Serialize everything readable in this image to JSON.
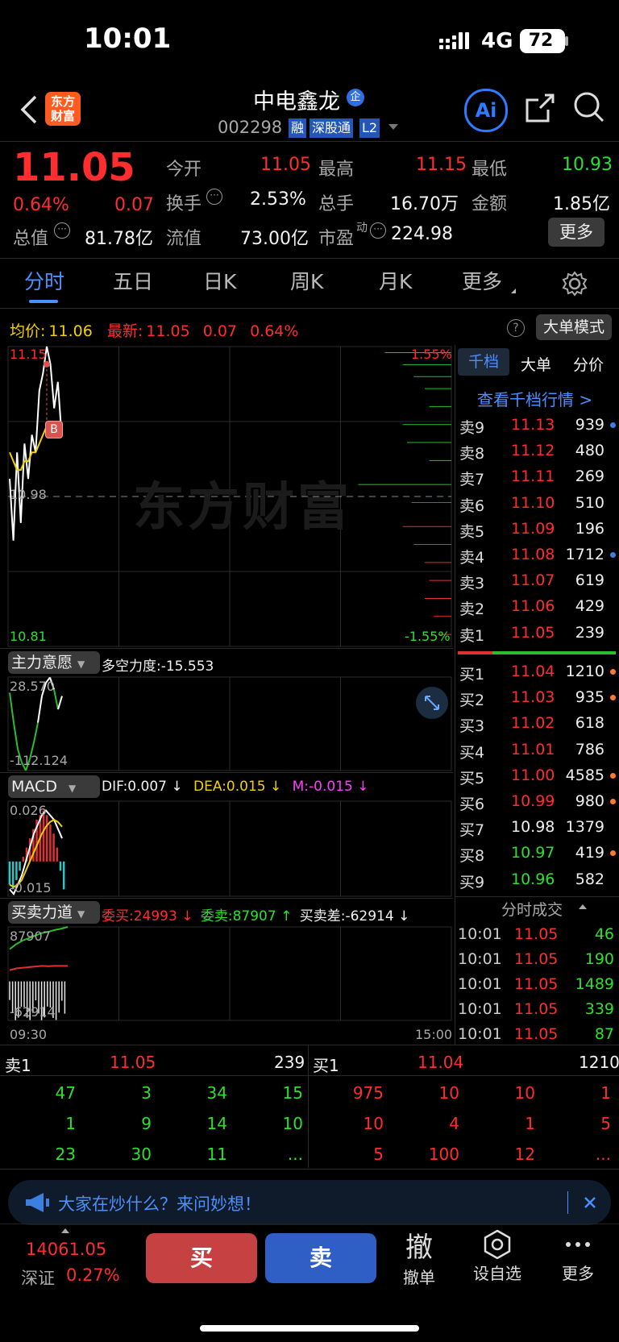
{
  "status_bar": {
    "time": "10:01",
    "network": "4G",
    "battery": "72"
  },
  "header": {
    "logo_line1": "东方",
    "logo_line2": "财富",
    "stock_name": "中电鑫龙",
    "enterprise_badge": "企",
    "stock_code": "002298",
    "tags": [
      "融",
      "深股通",
      "L2"
    ]
  },
  "quote": {
    "price": "11.05",
    "change_pct": "0.64%",
    "change": "0.07",
    "open_label": "今开",
    "open": "11.05",
    "high_label": "最高",
    "high": "11.15",
    "low_label": "最低",
    "low": "10.93",
    "turnover_label": "换手",
    "turnover": "2.53%",
    "volume_label": "总手",
    "volume": "16.70万",
    "amount_label": "金额",
    "amount": "1.85亿",
    "mktcap_label": "总值",
    "mktcap": "81.78亿",
    "float_label": "流值",
    "float": "73.00亿",
    "pe_label": "市盈",
    "pe_sup": "动",
    "pe": "224.98",
    "more_label": "更多"
  },
  "tabs": [
    "分时",
    "五日",
    "日K",
    "周K",
    "月K",
    "更多"
  ],
  "chart_header": {
    "avg_label": "均价:",
    "avg": "11.06",
    "latest_label": "最新:",
    "latest": "11.05",
    "chg": "0.07",
    "pct": "0.64%",
    "mode_label": "大单模式"
  },
  "chart_data": [
    {
      "type": "line",
      "title": "分时",
      "y_top_label": "11.15",
      "y_mid_label": "10.98",
      "y_bottom_label": "10.81",
      "right_top_label": "1.55%",
      "right_bottom_label": "-1.55%",
      "ylim": [
        10.81,
        11.15
      ],
      "x_labels": [
        "09:30",
        "15:00"
      ],
      "marker": "B",
      "watermark": "东方财富",
      "series": [
        {
          "name": "最新",
          "values": [
            11.0,
            10.93,
            11.03,
            10.95,
            11.04,
            11.0,
            11.05,
            11.03,
            11.1,
            11.12,
            11.15,
            11.13,
            11.08,
            11.11,
            11.05
          ]
        },
        {
          "name": "均价",
          "values": [
            11.03,
            11.02,
            11.01,
            11.01,
            11.02,
            11.02,
            11.03,
            11.03,
            11.04,
            11.05,
            11.06,
            11.06,
            11.06,
            11.06,
            11.06
          ]
        }
      ]
    },
    {
      "type": "line",
      "title": "主力意愿",
      "indicator_label": "多空力度:-15.553",
      "y_top_label": "28.570",
      "y_bottom_label": "-112.124",
      "ylim": [
        -112.124,
        28.57
      ],
      "series": [
        {
          "name": "line",
          "values": [
            5,
            -40,
            -80,
            -100,
            -112,
            -95,
            -70,
            -40,
            0,
            20,
            28,
            10,
            -20,
            0
          ]
        }
      ]
    },
    {
      "type": "bar",
      "title": "MACD",
      "dif_label": "DIF:0.007 ↓",
      "dea_label": "DEA:0.015 ↓",
      "m_label": "M:-0.015 ↓",
      "y_top_label": "0.026",
      "y_bottom_label": "-0.015",
      "ylim": [
        -0.015,
        0.026
      ],
      "bars": [
        -0.01,
        -0.012,
        -0.008,
        -0.004,
        0.002,
        0.006,
        0.01,
        0.014,
        0.018,
        0.02,
        0.022,
        0.02,
        0.016,
        0.012,
        0.006,
        -0.004,
        -0.012
      ]
    },
    {
      "type": "area",
      "title": "买卖力道",
      "buy_label": "委买:24993 ↓",
      "sell_label": "委卖:87907 ↑",
      "diff_label": "买卖差:-62914 ↓",
      "y_top_label": "87907",
      "y_bottom_label": "-62914",
      "ylim": [
        -62914,
        87907
      ]
    }
  ],
  "orderbook": {
    "tabs": [
      "千档",
      "大单",
      "分价"
    ],
    "view_all": "查看千档行情 >",
    "asks": [
      {
        "label": "卖9",
        "price": "11.13",
        "vol": "939",
        "dot": "blue"
      },
      {
        "label": "卖8",
        "price": "11.12",
        "vol": "480",
        "dot": ""
      },
      {
        "label": "卖7",
        "price": "11.11",
        "vol": "269",
        "dot": ""
      },
      {
        "label": "卖6",
        "price": "11.10",
        "vol": "510",
        "dot": ""
      },
      {
        "label": "卖5",
        "price": "11.09",
        "vol": "196",
        "dot": ""
      },
      {
        "label": "卖4",
        "price": "11.08",
        "vol": "1712",
        "dot": "blue"
      },
      {
        "label": "卖3",
        "price": "11.07",
        "vol": "619",
        "dot": ""
      },
      {
        "label": "卖2",
        "price": "11.06",
        "vol": "429",
        "dot": ""
      },
      {
        "label": "卖1",
        "price": "11.05",
        "vol": "239",
        "dot": ""
      }
    ],
    "bids": [
      {
        "label": "买1",
        "price": "11.04",
        "vol": "1210",
        "dot": "orange",
        "color": "red"
      },
      {
        "label": "买2",
        "price": "11.03",
        "vol": "935",
        "dot": "orange",
        "color": "red"
      },
      {
        "label": "买3",
        "price": "11.02",
        "vol": "618",
        "dot": "",
        "color": "red"
      },
      {
        "label": "买4",
        "price": "11.01",
        "vol": "786",
        "dot": "",
        "color": "red"
      },
      {
        "label": "买5",
        "price": "11.00",
        "vol": "4585",
        "dot": "orange",
        "color": "red"
      },
      {
        "label": "买6",
        "price": "10.99",
        "vol": "980",
        "dot": "orange",
        "color": "red"
      },
      {
        "label": "买7",
        "price": "10.98",
        "vol": "1379",
        "dot": "",
        "color": "white"
      },
      {
        "label": "买8",
        "price": "10.97",
        "vol": "419",
        "dot": "orange",
        "color": "green"
      },
      {
        "label": "买9",
        "price": "10.96",
        "vol": "582",
        "dot": "",
        "color": "green"
      }
    ],
    "trades_title": "分时成交",
    "trades": [
      {
        "time": "10:01",
        "price": "11.05",
        "vol": "46"
      },
      {
        "time": "10:01",
        "price": "11.05",
        "vol": "190"
      },
      {
        "time": "10:01",
        "price": "11.05",
        "vol": "1489"
      },
      {
        "time": "10:01",
        "price": "11.05",
        "vol": "339"
      },
      {
        "time": "10:01",
        "price": "11.05",
        "vol": "87"
      }
    ]
  },
  "queue": {
    "sell_label": "卖1",
    "sell_price": "11.05",
    "sell_vol": "239",
    "buy_label": "买1",
    "buy_price": "11.04",
    "buy_vol": "1210",
    "sell_rows": [
      [
        "47",
        "3",
        "34",
        "15"
      ],
      [
        "1",
        "9",
        "14",
        "10"
      ],
      [
        "23",
        "30",
        "11",
        "..."
      ]
    ],
    "buy_rows": [
      [
        "975",
        "10",
        "10",
        "1"
      ],
      [
        "10",
        "4",
        "1",
        "5"
      ],
      [
        "5",
        "100",
        "12",
        "..."
      ]
    ]
  },
  "banner": {
    "text": "大家在炒什么？来问妙想！"
  },
  "bottom_bar": {
    "index_value": "14061.05",
    "index_name": "深证",
    "index_pct": "0.27%",
    "buy_label": "买",
    "sell_label": "卖",
    "cancel_icon_text": "撤",
    "cancel_label": "撤单",
    "watch_label": "设自选",
    "more_label": "更多"
  }
}
